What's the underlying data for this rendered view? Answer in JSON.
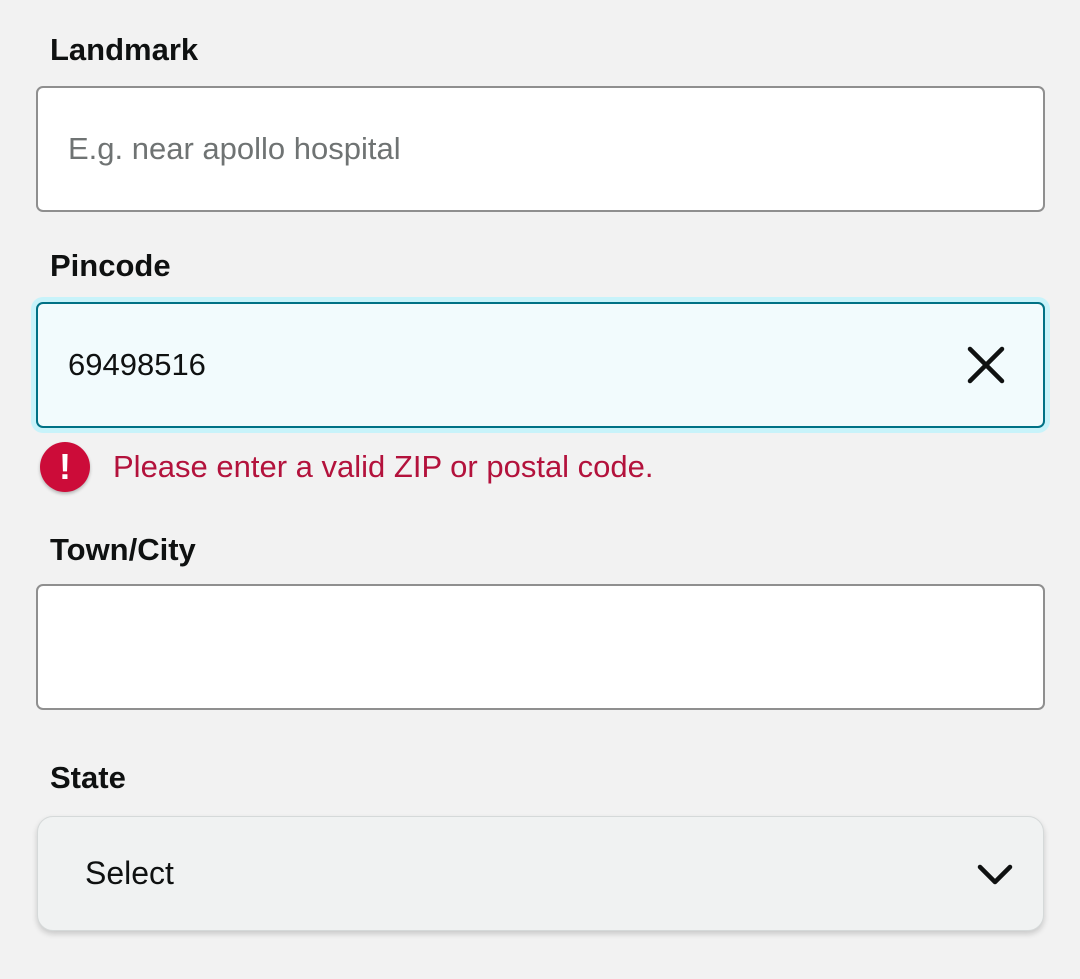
{
  "landmark": {
    "label": "Landmark",
    "placeholder": "E.g. near apollo hospital",
    "value": ""
  },
  "pincode": {
    "label": "Pincode",
    "value": "69498516",
    "clear_icon": "close-icon",
    "error_icon": "exclamation-icon",
    "error": "Please enter a valid ZIP or postal code."
  },
  "town_city": {
    "label": "Town/City",
    "value": ""
  },
  "state": {
    "label": "State",
    "selected": "Select",
    "dropdown_icon": "chevron-down-icon"
  },
  "colors": {
    "background": "#f2f2f2",
    "focus_border": "#007185",
    "focus_glow": "#c8f3fa",
    "error": "#cc0c39",
    "error_text": "#b3123c"
  }
}
